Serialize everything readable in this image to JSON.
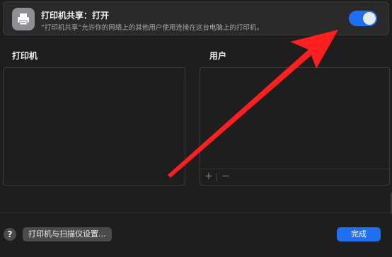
{
  "header": {
    "icon": "printer-icon",
    "title": "打印机共享：打开",
    "description": "“打印机共享”允许你的网络上的其他用户使用连接在这台电脑上的打印机。",
    "toggle_on": true,
    "toggle_color": "#1f6ff1"
  },
  "printers_panel": {
    "label": "打印机"
  },
  "users_panel": {
    "label": "用户",
    "add_label": "+",
    "remove_label": "−"
  },
  "footer": {
    "help_label": "?",
    "settings_button": "打印机与扫描仪设置...",
    "done_button": "完成"
  },
  "annotation": {
    "type": "arrow",
    "color": "#ff1f1f",
    "points_to": "toggle"
  }
}
